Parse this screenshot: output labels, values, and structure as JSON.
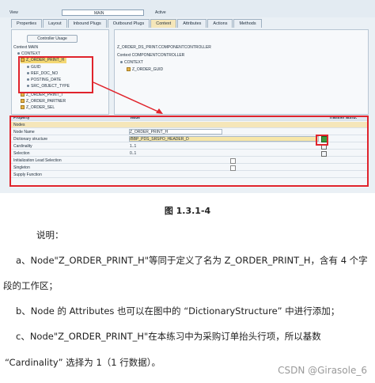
{
  "screenshot": {
    "view_label": "View",
    "view_value": "MAIN",
    "status_label": "Active",
    "tabs": [
      "Properties",
      "Layout",
      "Inbound Plugs",
      "Outbound Plugs",
      "Context",
      "Attributes",
      "Actions",
      "Methods"
    ],
    "controller_usage_button": "Controller Usage",
    "left_header": "Context MAIN",
    "left_tree": {
      "context": "CONTEXT",
      "selected_node": "Z_ORDER_PRINT_H",
      "attributes": [
        "GUID",
        "REF_DOC_NO",
        "POSTING_DATE",
        "SRC_OBJECT_TYPE"
      ],
      "other_nodes": [
        "Z_ORDER_PRINT_I",
        "Z_ORDER_PARTNER",
        "Z_ORDER_SEL"
      ]
    },
    "right_top": "Z_ORDER_DS_PRINT.COMPONENTCONTROLLER",
    "right_header": "Context COMPONENTCONTROLLER",
    "right_tree": {
      "context": "CONTEXT",
      "node": "Z_ORDER_GUID"
    },
    "properties": {
      "headers": [
        "Property",
        "Value",
        "Transfer attrib."
      ],
      "section": "Nodes",
      "rows": [
        {
          "property": "Node Name",
          "value": "Z_ORDER_PRINT_H"
        },
        {
          "property": "Dictionary structure",
          "value": "/BBP_PDS_SRSPO_HEADER_D"
        },
        {
          "property": "Cardinality",
          "value": "1..1"
        },
        {
          "property": "Selection",
          "value": "0..1"
        },
        {
          "property": "Initialization Lead Selection",
          "value": ""
        },
        {
          "property": "Singleton",
          "value": ""
        },
        {
          "property": "Supply Function",
          "value": ""
        }
      ]
    }
  },
  "caption": "图 1.3.1-4",
  "paragraphs": {
    "p1": "说明：",
    "p2": "a、Node\"Z_ORDER_PRINT_H\"等同于定义了名为 Z_ORDER_PRINT_H，含有 4 个字",
    "p3": "段的工作区；",
    "p4": "b、Node 的 Attributes 也可以在图中的 “DictionaryStructure” 中进行添加；",
    "p5": "c、Node\"Z_ORDER_PRINT_H\"在本练习中为采购订单抬头行项，所以基数",
    "p6": "“Cardinality” 选择为 1（1 行数据）。"
  },
  "watermark": "CSDN @Girasole_6",
  "colors": {
    "highlight_box": "#e0242c",
    "selected_node": "#f4d873",
    "active_tab": "#f5e6b9"
  }
}
